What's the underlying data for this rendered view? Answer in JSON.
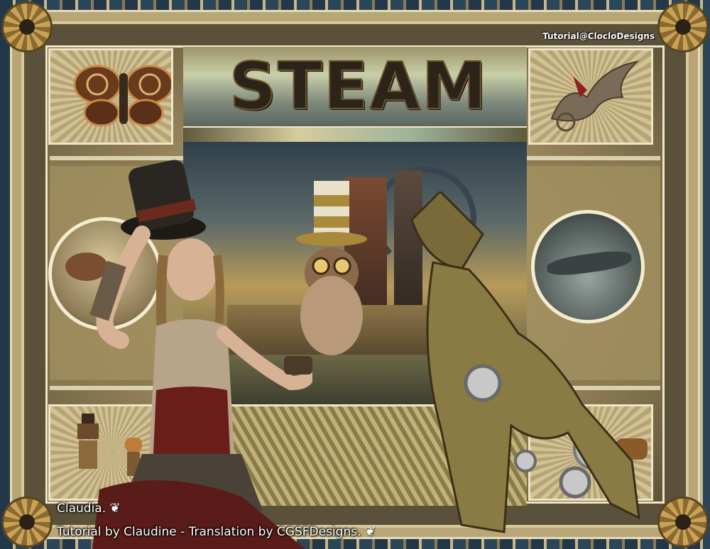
{
  "artwork": {
    "title_text": "STEAM",
    "watermark": "Tutorial@ClocloDesigns",
    "credits": {
      "line1": "Claudia.",
      "line2": "Tutorial by Claudine - Translation by CGSFDesigns."
    },
    "icons": {
      "gear": "gear-icon",
      "signature_tree": "tree-icon",
      "watermark_emblem": "emblem-icon"
    },
    "colors": {
      "frame_blue": "#223848",
      "frame_gold": "#c9b78a",
      "title_dark": "#2c2418",
      "text_white": "#ffffff"
    }
  }
}
